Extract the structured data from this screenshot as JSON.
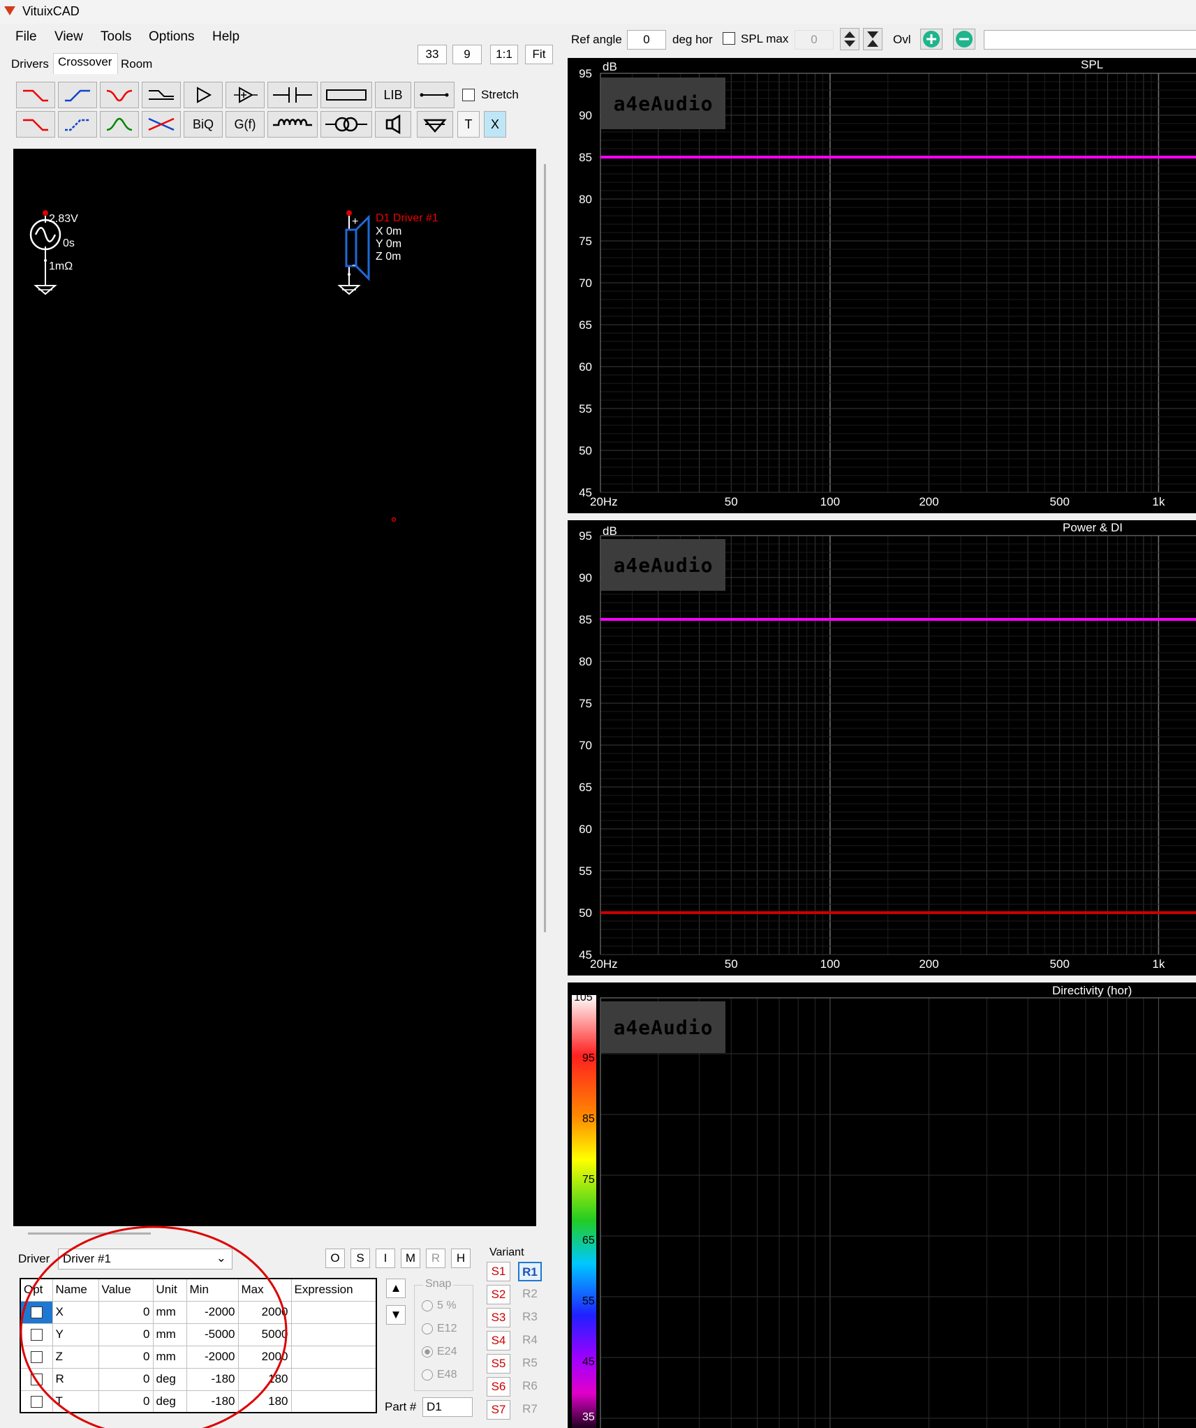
{
  "app": {
    "title": "VituixCAD"
  },
  "menu": [
    "File",
    "View",
    "Tools",
    "Options",
    "Help"
  ],
  "tabs": [
    "Drivers",
    "Crossover",
    "Room"
  ],
  "zoom_buttons": [
    "33",
    "9",
    "1:1",
    "Fit"
  ],
  "toolbar": {
    "row1_text": {
      "lib": "LIB"
    },
    "row2_text": {
      "biq": "BiQ",
      "gf": "G(f)",
      "t": "T",
      "x": "X"
    },
    "stretch_label": "Stretch"
  },
  "top_controls": {
    "ref_angle_label": "Ref angle",
    "ref_angle_value": "0",
    "deg_hor_label": "deg hor",
    "spl_max_label": "SPL max",
    "spl_max_value": "0",
    "ovl_label": "Ovl"
  },
  "schematic": {
    "source": {
      "voltage": "2.83V",
      "delay": "0s",
      "resistance": "1mΩ"
    },
    "driver": {
      "label": "D1 Driver #1",
      "x": "X 0m",
      "y": "Y 0m",
      "z": "Z 0m",
      "plus": "+",
      "minus": "-"
    }
  },
  "graphs": {
    "spl": {
      "title": "SPL",
      "unit": "dB",
      "yticks": [
        "95",
        "90",
        "85",
        "80",
        "75",
        "70",
        "65",
        "60",
        "55",
        "50",
        "45"
      ],
      "xticks": [
        "20Hz",
        "50",
        "100",
        "200",
        "500",
        "1k"
      ]
    },
    "power": {
      "title": "Power & DI",
      "unit": "dB",
      "yticks": [
        "95",
        "90",
        "85",
        "80",
        "75",
        "70",
        "65",
        "60",
        "55",
        "50",
        "45"
      ],
      "xticks": [
        "20Hz",
        "50",
        "100",
        "200",
        "500",
        "1k"
      ]
    },
    "directivity": {
      "title": "Directivity (hor)",
      "scale": [
        "105",
        "95",
        "85",
        "75",
        "65",
        "55",
        "45",
        "35"
      ]
    },
    "logo": "a4eAudio",
    "colors": {
      "spl_line": "#ff00ff",
      "di_line": "#cc0000"
    }
  },
  "chart_data": [
    {
      "type": "line",
      "title": "SPL",
      "ylabel": "dB",
      "ylim": [
        45,
        95
      ],
      "xscale": "log",
      "xlim": [
        20,
        1300
      ],
      "series": [
        {
          "values": [
            [
              20,
              85
            ],
            [
              1300,
              85
            ]
          ]
        }
      ]
    },
    {
      "type": "line",
      "title": "Power & DI",
      "ylabel": "dB",
      "ylim": [
        45,
        95
      ],
      "xscale": "log",
      "xlim": [
        20,
        1300
      ],
      "series": [
        {
          "values": [
            [
              20,
              85
            ],
            [
              1300,
              85
            ]
          ]
        },
        {
          "values": [
            [
              20,
              50
            ],
            [
              1300,
              50
            ]
          ]
        }
      ]
    }
  ],
  "driver_panel": {
    "driver_label": "Driver",
    "driver_value": "Driver #1",
    "buttons": [
      "O",
      "S",
      "I",
      "M",
      "R",
      "H"
    ],
    "headers": [
      "Opt",
      "Name",
      "Value",
      "Unit",
      "Min",
      "Max",
      "Expression"
    ],
    "rows": [
      {
        "name": "X",
        "value": "0",
        "unit": "mm",
        "min": "-2000",
        "max": "2000"
      },
      {
        "name": "Y",
        "value": "0",
        "unit": "mm",
        "min": "-5000",
        "max": "5000"
      },
      {
        "name": "Z",
        "value": "0",
        "unit": "mm",
        "min": "-2000",
        "max": "2000"
      },
      {
        "name": "R",
        "value": "0",
        "unit": "deg",
        "min": "-180",
        "max": "180"
      },
      {
        "name": "T",
        "value": "0",
        "unit": "deg",
        "min": "-180",
        "max": "180"
      }
    ],
    "snap_label": "Snap",
    "snap_options": [
      "5 %",
      "E12",
      "E24",
      "E48"
    ],
    "part_label": "Part #",
    "part_value": "D1",
    "variant_label": "Variant",
    "variants_s": [
      "S1",
      "S2",
      "S3",
      "S4",
      "S5",
      "S6",
      "S7"
    ],
    "variants_r": [
      "R1",
      "R2",
      "R3",
      "R4",
      "R5",
      "R6",
      "R7"
    ]
  }
}
